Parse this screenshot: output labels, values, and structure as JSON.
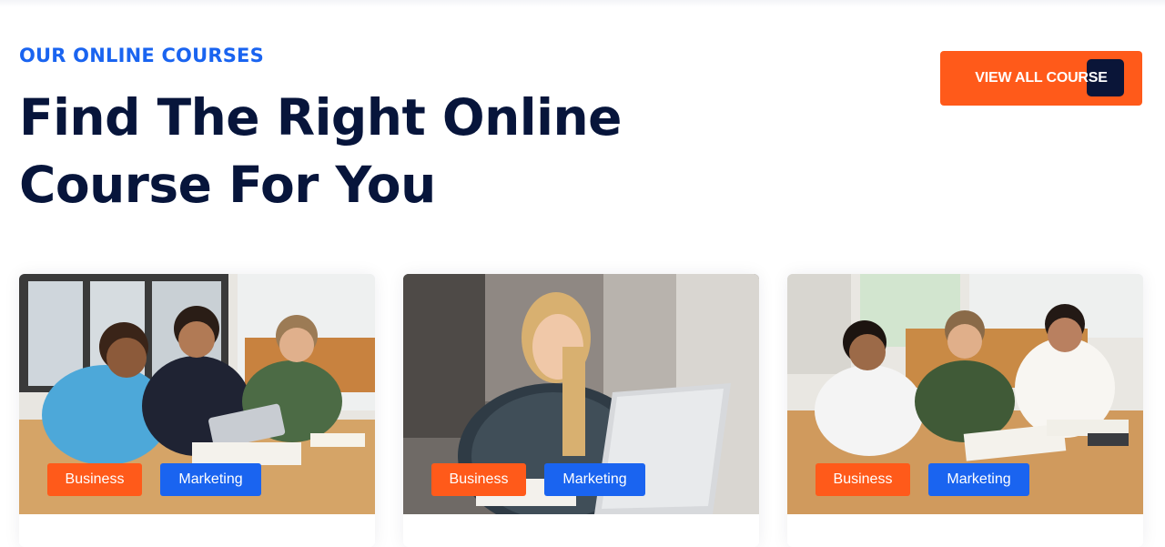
{
  "section": {
    "eyebrow": "OUR ONLINE COURSES",
    "headline": "Find The Right Online Course For You",
    "view_all_label": "VIEW ALL COURSE"
  },
  "colors": {
    "accent": "#ff5a1a",
    "primary": "#1a64f0",
    "heading": "#07153b"
  },
  "cards": [
    {
      "tags": [
        "Business",
        "Marketing"
      ]
    },
    {
      "tags": [
        "Business",
        "Marketing"
      ]
    },
    {
      "tags": [
        "Business",
        "Marketing"
      ]
    }
  ]
}
